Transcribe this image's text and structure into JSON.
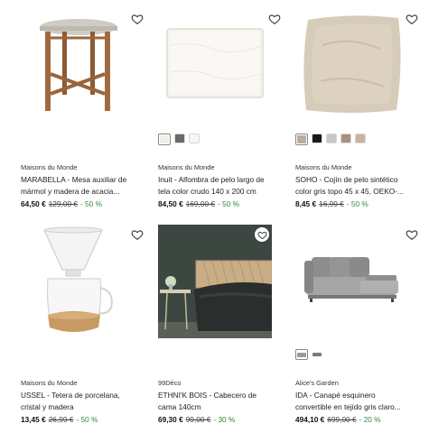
{
  "products": [
    {
      "brand": "Maisons du Monde",
      "title": "MARABELLA - Mesa auxiliar de mármol y madera de acacia...",
      "price": "64,50 €",
      "old_price": "129,00 €",
      "discount": "- 50 %",
      "swatches": []
    },
    {
      "brand": "Maisons du Monde",
      "title": "Inuit - Alfombra de pelo largo de tela color crudo 140 x 200 cm",
      "price": "84,50 €",
      "old_price": "169,00 €",
      "discount": "- 50 %",
      "swatches": [
        "#f2efe8",
        "#6a6a6a",
        "#f7f6f2"
      ]
    },
    {
      "brand": "Maisons du Monde",
      "title": "SOHO - Cojín de pelo sintético color gris topo 45 x 45, OEKO-...",
      "price": "8,45 €",
      "old_price": "16,99 €",
      "discount": "- 50 %",
      "swatches": [
        "#b9ae9c",
        "#1a1a1a",
        "#c9c7c4",
        "#a98f7e",
        "#c8b59a"
      ]
    },
    {
      "brand": "Maisons du Monde",
      "title": "USSEL - Tetera de porcelana, cristal y madera",
      "price": "13,45 €",
      "old_price": "26,99 €",
      "discount": "- 50 %",
      "swatches": []
    },
    {
      "brand": "99Déco",
      "title": "ETHNI'K BOIS - Cabecero de cama 140cm",
      "price": "69,30 €",
      "old_price": "99,00 €",
      "discount": "- 30 %",
      "swatches": []
    },
    {
      "brand": "Alice's Garden",
      "title": "IDA - Canapé esquinero convertible en tejido gris claro...",
      "price": "494,10 €",
      "old_price": "699,00 €",
      "discount": "- 20 %",
      "swatches": [
        "#9a9a9a",
        "#7a7a7a"
      ]
    }
  ],
  "colors": {
    "discount": "#2f8a3c"
  }
}
